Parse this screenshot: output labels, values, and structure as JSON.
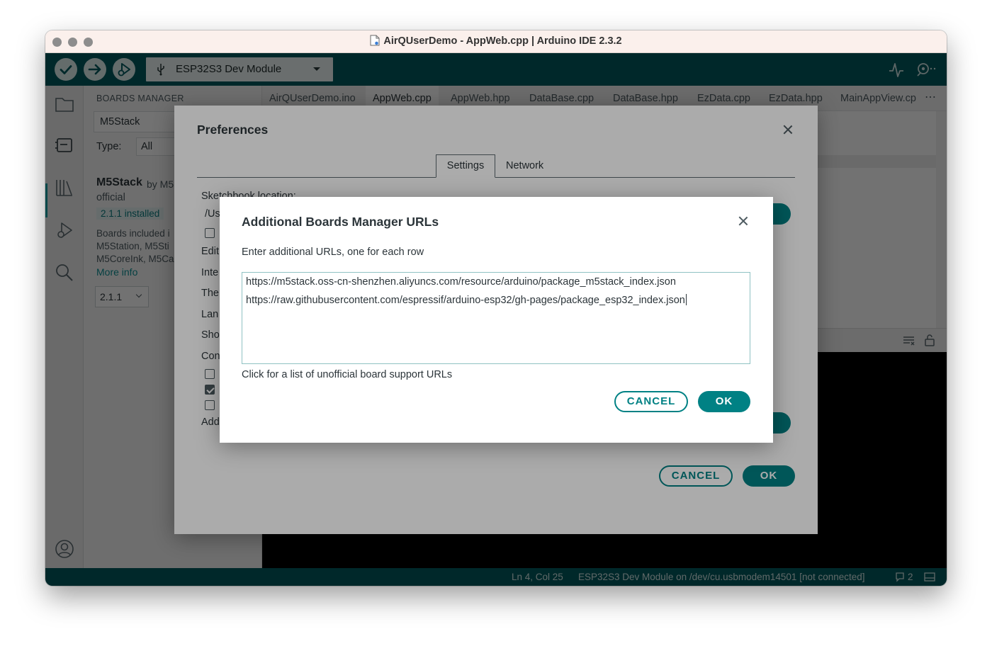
{
  "window": {
    "title": "AirQUserDemo - AppWeb.cpp | Arduino IDE 2.3.2"
  },
  "toolbar": {
    "verify_icon": "check-icon",
    "upload_icon": "arrow-right-icon",
    "debug_icon": "debug-icon",
    "board_label": "ESP32S3 Dev Module",
    "serial_plotter_icon": "serial-plotter-icon",
    "serial_monitor_icon": "serial-monitor-icon"
  },
  "activity_bar": [
    "folder-icon",
    "boards-manager-icon",
    "library-icon",
    "debug-icon",
    "search-icon",
    "account-icon"
  ],
  "boards_manager": {
    "title": "BOARDS MANAGER",
    "search_value": "M5Stack",
    "type_label": "Type:",
    "type_value": "All",
    "item": {
      "name": "M5Stack",
      "author": "by M5",
      "official": "official",
      "installed": "2.1.1 installed",
      "desc_lines": [
        "Boards included i",
        "M5Station, M5Sti",
        "M5CoreInk, M5Ca"
      ],
      "more_info": "More info",
      "version": "2.1.1"
    }
  },
  "tabs": [
    "AirQUserDemo.ino",
    "AppWeb.cpp",
    "AppWeb.hpp",
    "DataBase.cpp",
    "DataBase.hpp",
    "EzData.cpp",
    "EzData.hpp",
    "MainAppView.cp"
  ],
  "tabs_more": "⋯",
  "status": {
    "position": "Ln 4, Col 25",
    "board": "ESP32S3 Dev Module on /dev/cu.usbmodem14501 [not connected]",
    "notifications": "2"
  },
  "preferences": {
    "title": "Preferences",
    "tabs": [
      "Settings",
      "Network"
    ],
    "labels": [
      "Sketchbook location:",
      "/Us",
      "Edit",
      "Inte",
      "The",
      "Lan",
      "Sho",
      "Con",
      "Add"
    ],
    "checkboxes": [
      false,
      false,
      true,
      false
    ],
    "cancel": "CANCEL",
    "ok": "OK"
  },
  "urls_dialog": {
    "title": "Additional Boards Manager URLs",
    "description": "Enter additional URLs, one for each row",
    "urls": [
      "https://m5stack.oss-cn-shenzhen.aliyuncs.com/resource/arduino/package_m5stack_index.json",
      "https://raw.githubusercontent.com/espressif/arduino-esp32/gh-pages/package_esp32_index.json"
    ],
    "link_text": "Click for a list of unofficial board support URLs",
    "cancel": "CANCEL",
    "ok": "OK"
  },
  "colors": {
    "accent": "#008184",
    "toolbar": "#005c5f"
  }
}
